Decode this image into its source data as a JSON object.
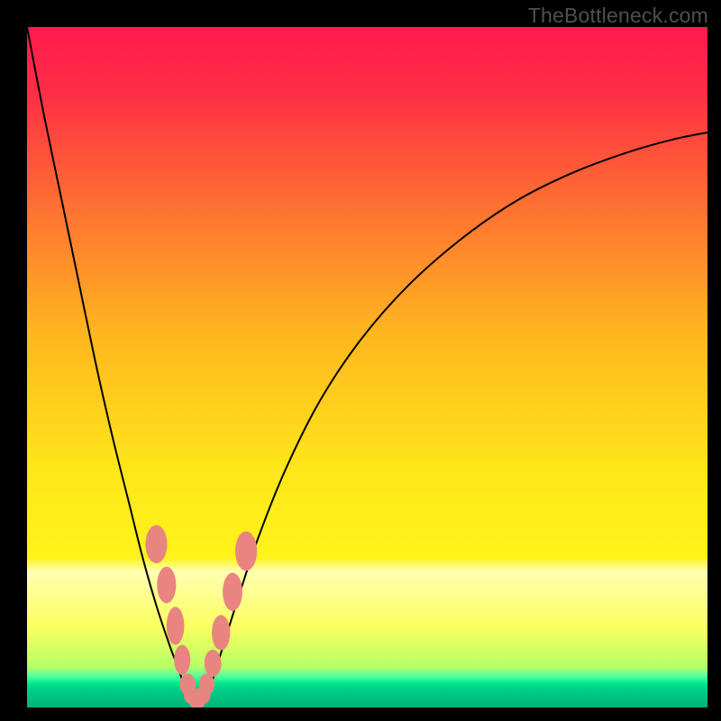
{
  "watermark": "TheBottleneck.com",
  "chart_data": {
    "type": "line",
    "title": "",
    "xlabel": "",
    "ylabel": "",
    "xlim": [
      0,
      100
    ],
    "ylim": [
      0,
      100
    ],
    "grid": false,
    "legend": false,
    "gradient_stops": [
      {
        "pos": 0.0,
        "color": "#ff1a4f"
      },
      {
        "pos": 0.1,
        "color": "#ff2f44"
      },
      {
        "pos": 0.25,
        "color": "#ff6b33"
      },
      {
        "pos": 0.45,
        "color": "#ffb61f"
      },
      {
        "pos": 0.65,
        "color": "#ffe61a"
      },
      {
        "pos": 0.78,
        "color": "#fff31a"
      },
      {
        "pos": 0.8,
        "color": "#ffffb0"
      },
      {
        "pos": 0.88,
        "color": "#fcff61"
      },
      {
        "pos": 0.94,
        "color": "#b8ff66"
      },
      {
        "pos": 0.955,
        "color": "#4dffa6"
      },
      {
        "pos": 0.965,
        "color": "#00e68a"
      },
      {
        "pos": 0.975,
        "color": "#00cc88"
      },
      {
        "pos": 1.0,
        "color": "#00b37a"
      }
    ],
    "series": [
      {
        "name": "left-branch",
        "x": [
          0,
          2.5,
          5,
          7.5,
          10,
          12.5,
          15,
          17,
          19,
          21,
          22.5,
          23.4
        ],
        "y": [
          100,
          87,
          75,
          63,
          51,
          40,
          30,
          22,
          15,
          9,
          5,
          2
        ]
      },
      {
        "name": "valley-floor",
        "x": [
          23.4,
          24.2,
          25.0,
          25.8,
          26.6
        ],
        "y": [
          2,
          1,
          0.6,
          1,
          2
        ]
      },
      {
        "name": "right-branch",
        "x": [
          26.6,
          28.5,
          31,
          34,
          38,
          43,
          49,
          56,
          64,
          72,
          80,
          88,
          95,
          100
        ],
        "y": [
          2,
          8,
          16,
          25,
          35,
          45,
          54,
          62,
          69,
          74.5,
          78.5,
          81.5,
          83.5,
          84.5
        ]
      }
    ],
    "markers": {
      "name": "beads",
      "color": "#e98580",
      "points": [
        {
          "x": 19.0,
          "y": 24.0,
          "w": 3.2,
          "h": 5.6
        },
        {
          "x": 20.5,
          "y": 18.0,
          "w": 2.8,
          "h": 5.4
        },
        {
          "x": 21.8,
          "y": 12.0,
          "w": 2.6,
          "h": 5.6
        },
        {
          "x": 22.8,
          "y": 7.0,
          "w": 2.4,
          "h": 4.4
        },
        {
          "x": 23.6,
          "y": 3.4,
          "w": 2.3,
          "h": 3.2
        },
        {
          "x": 24.3,
          "y": 1.7,
          "w": 2.5,
          "h": 2.5
        },
        {
          "x": 25.0,
          "y": 1.0,
          "w": 2.5,
          "h": 2.5
        },
        {
          "x": 25.7,
          "y": 1.7,
          "w": 2.5,
          "h": 2.5
        },
        {
          "x": 26.4,
          "y": 3.4,
          "w": 2.3,
          "h": 3.2
        },
        {
          "x": 27.3,
          "y": 6.5,
          "w": 2.5,
          "h": 4.0
        },
        {
          "x": 28.5,
          "y": 11.0,
          "w": 2.7,
          "h": 5.2
        },
        {
          "x": 30.2,
          "y": 17.0,
          "w": 2.9,
          "h": 5.6
        },
        {
          "x": 32.2,
          "y": 23.0,
          "w": 3.2,
          "h": 5.8
        }
      ]
    }
  }
}
